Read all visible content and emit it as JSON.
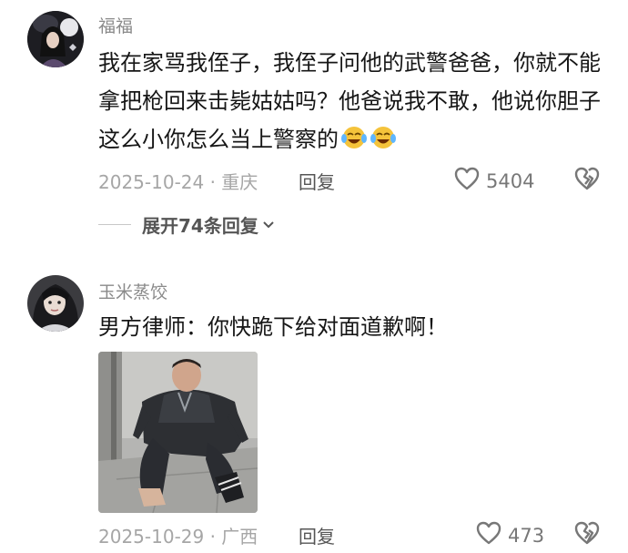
{
  "comments": [
    {
      "username": "福福",
      "text": "我在家骂我侄子，我侄子问他的武警爸爸，你就不能拿把枪回来击毙姑姑吗？他爸说我不敢，他说你胆子这么小你怎么当上警察的",
      "emojis": [
        "crying-laughing-emoji",
        "crying-laughing-emoji"
      ],
      "date_location": "2025-10-24 · 重庆",
      "reply_label": "回复",
      "likes": "5404",
      "expand_label": "展开74条回复"
    },
    {
      "username": "玉米蒸饺",
      "text": "男方律师：你快跪下给对面道歉啊！",
      "image": "photo-of-man-kneeling",
      "date_location": "2025-10-29 · 广西",
      "reply_label": "回复",
      "likes": "473"
    }
  ],
  "icons": {
    "like": "heart-outline-icon",
    "dislike": "broken-heart-icon",
    "expand": "chevron-down-icon"
  },
  "colors": {
    "text": "#161616",
    "username": "#8a8a8a",
    "meta": "#a6a6a6",
    "reply": "#555555"
  }
}
